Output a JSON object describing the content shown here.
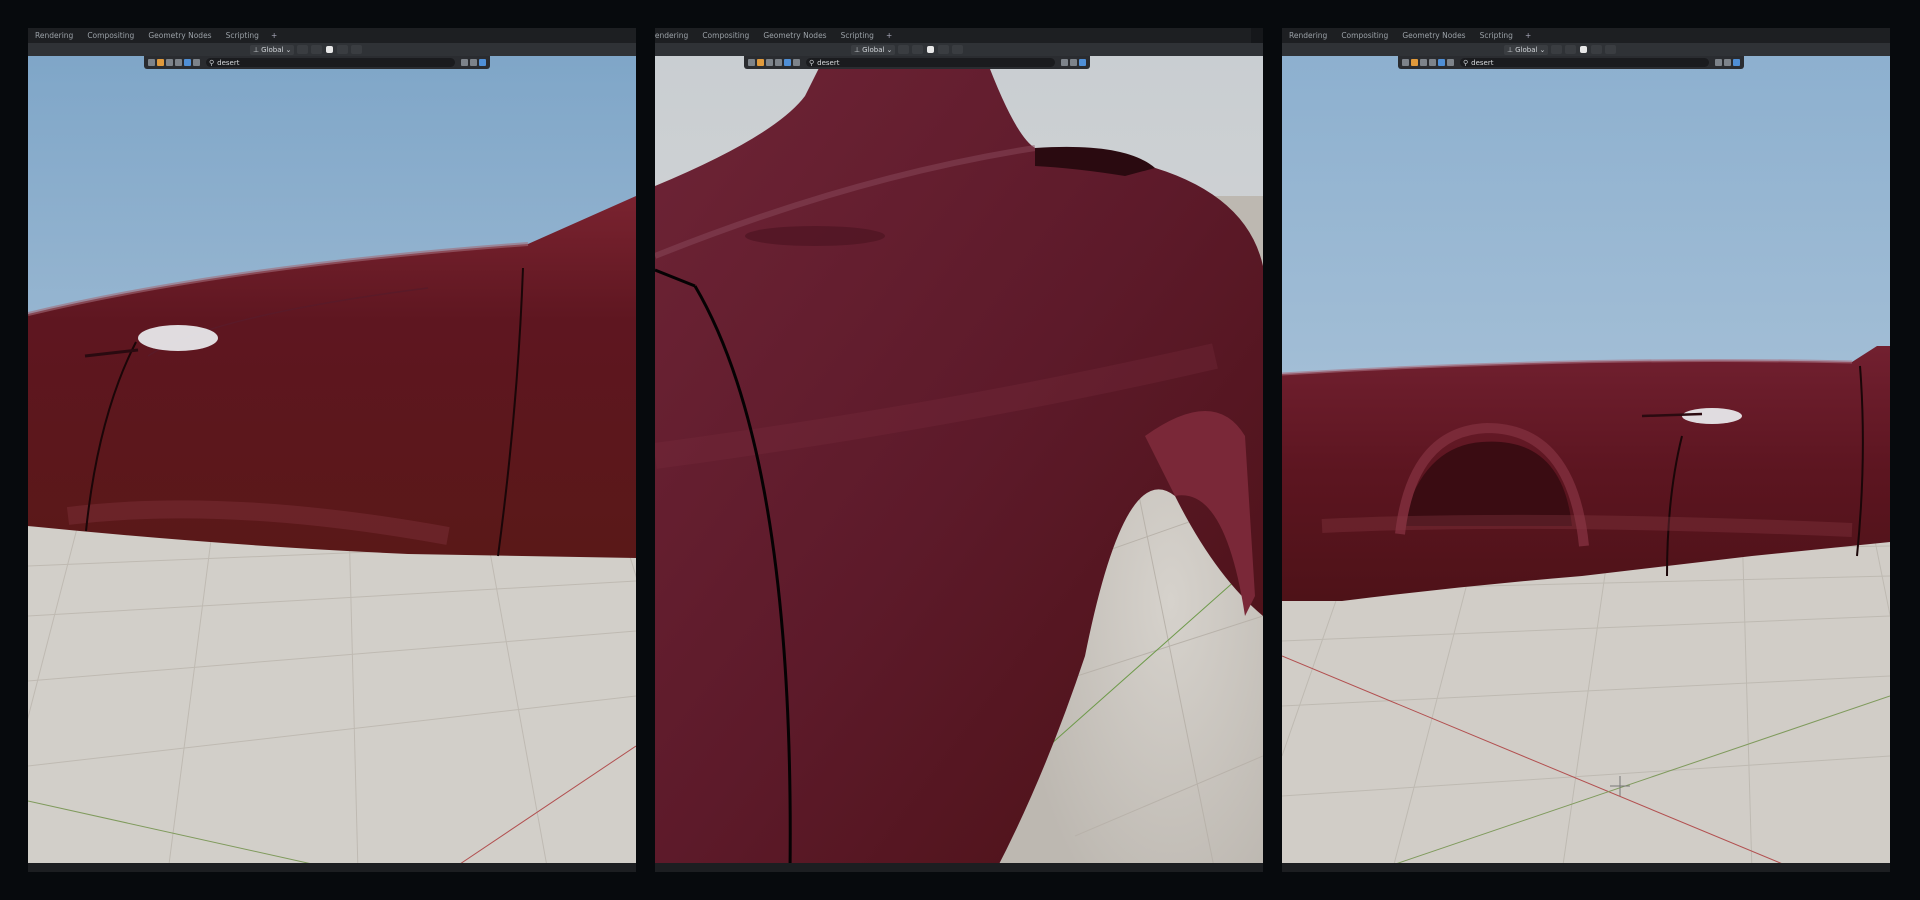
{
  "workspace_tabs": [
    "Rendering",
    "Compositing",
    "Geometry Nodes",
    "Scripting"
  ],
  "add_workspace": "+",
  "header": {
    "orientation": "Global"
  },
  "outliner": {
    "search_value": "desert"
  },
  "icons": {
    "orientation": "axes-icon",
    "search": "search-icon",
    "filter": "filter-icon",
    "bookmark": "bookmark-icon"
  },
  "colors": {
    "car_paint": "#6b1a22",
    "sky_top": "#8bb0cf",
    "floor": "#d2cfc9",
    "grid_line": "#bfbab2",
    "x_axis": "#b24a4a",
    "y_axis": "#6e9a4a",
    "header_bg": "#2f3236",
    "tabs_bg": "#1d1f22"
  }
}
